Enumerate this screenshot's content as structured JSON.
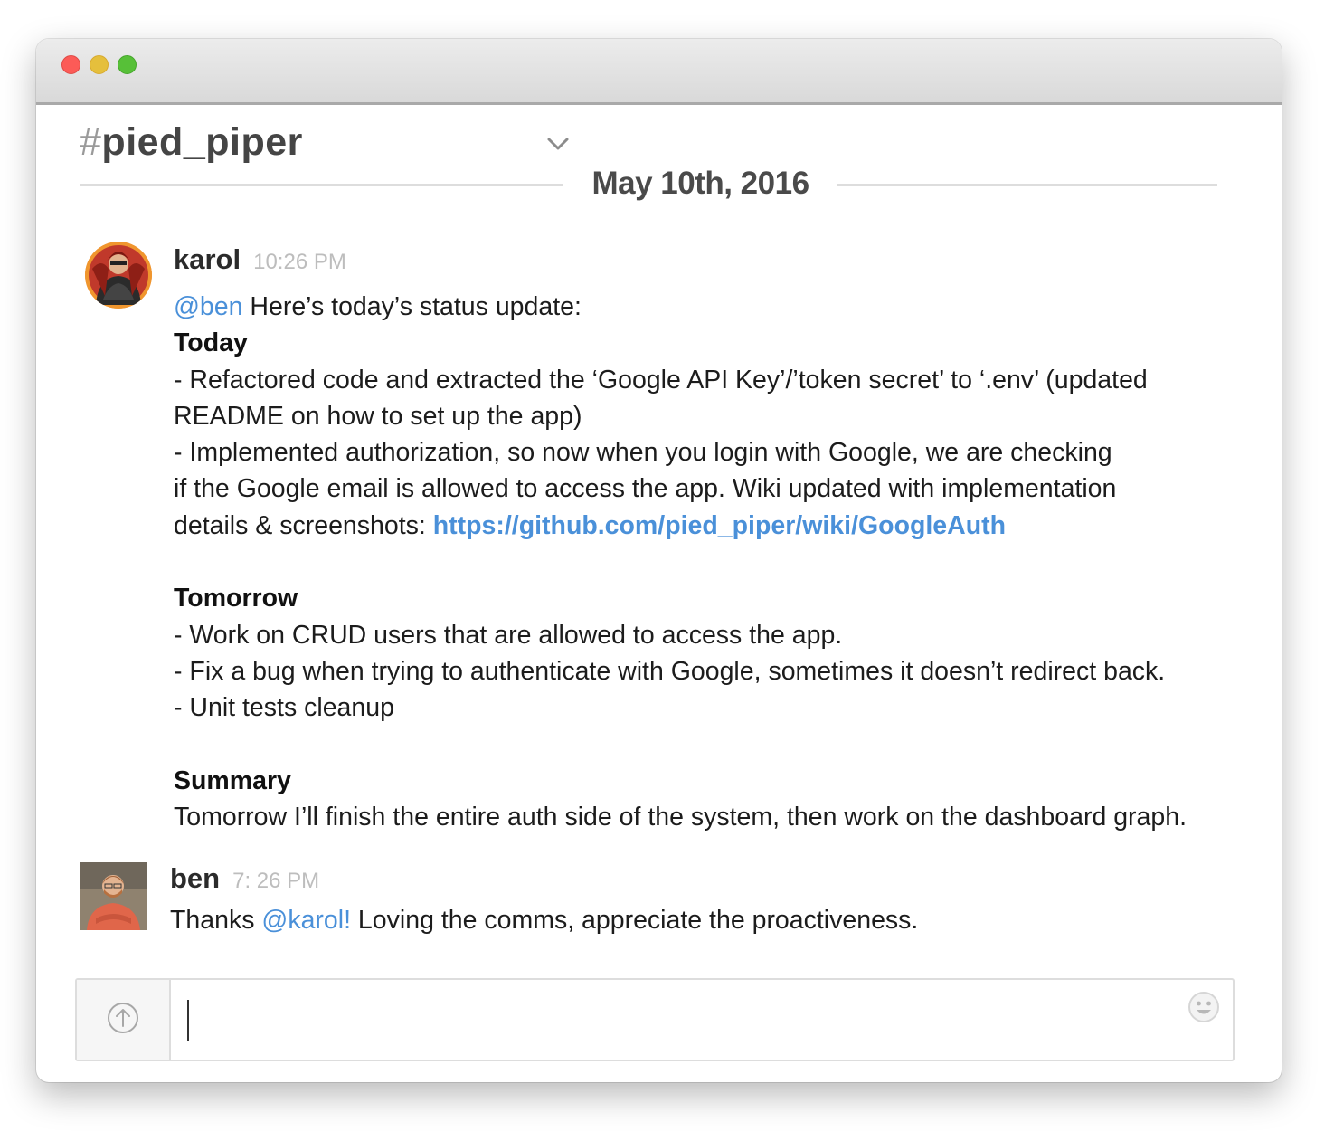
{
  "channel": {
    "hash": "#",
    "name": "pied_piper"
  },
  "date_divider": "May 10th, 2016",
  "messages": [
    {
      "author": "karol",
      "time": "10:26 PM",
      "lines": {
        "l1_mention": "@ben",
        "l1_text": " Here’s today’s status update:",
        "today_heading": "Today",
        "l3": "- Refactored code and extracted the ‘Google API Key’/’token secret’ to ‘.env’ (updated",
        "l4": "README on how to set up the app)",
        "l5": "- Implemented authorization, so now when you login with Google, we are checking",
        "l6": "if the Google email is allowed to access the app. Wiki updated with implementation",
        "l7_text": "details & screenshots: ",
        "l7_link": "https://github.com/pied_piper/wiki/GoogleAuth",
        "tomorrow_heading": "Tomorrow",
        "l10": "- Work on CRUD users that are allowed to access the app.",
        "l11": "- Fix a bug when trying to authenticate with Google, sometimes it doesn’t redirect back.",
        "l12": "- Unit tests cleanup",
        "summary_heading": "Summary",
        "l15": "Tomorrow I’ll finish the entire auth side of the system, then work on the dashboard graph."
      }
    },
    {
      "author": "ben",
      "time": "7: 26 PM",
      "text_before": "Thanks ",
      "mention": "@karol!",
      "text_after": " Loving the comms, appreciate the proactiveness."
    }
  ],
  "composer": {
    "value": "",
    "placeholder": ""
  },
  "icons": {
    "upload": "arrow-up-circle-icon",
    "emoji": "smiley-face-icon",
    "dropdown": "chevron-down-icon"
  },
  "colors": {
    "mention": "#4a90d9",
    "close": "#fc5b57",
    "minimize": "#e5bf3c",
    "maximize": "#57c038"
  }
}
